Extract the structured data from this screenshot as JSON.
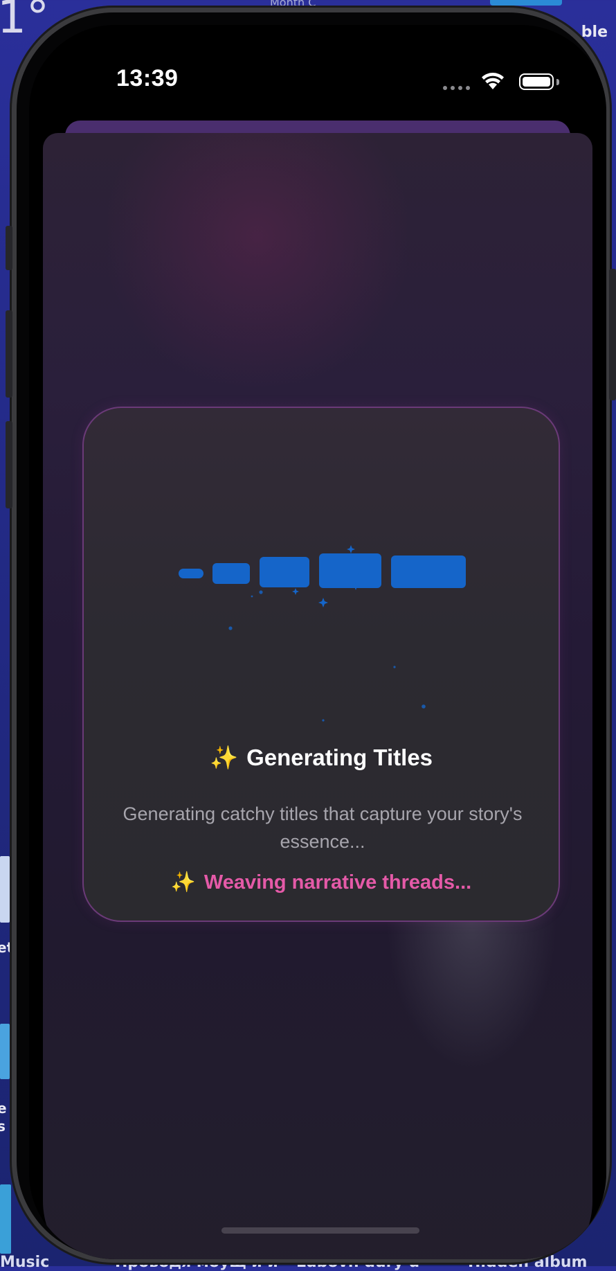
{
  "desktop": {
    "top_left_fragment": "1°",
    "top_fragment": "Month C",
    "top_right_fragment": "ble",
    "left_fragment_1": "et",
    "left_fragment_2": "e",
    "left_fragment_3": "s i",
    "bottom_labels": [
      "Music",
      "Проводя моущ и и",
      "Lubovn dury u",
      "Hidden album"
    ]
  },
  "status_bar": {
    "time": "13:39",
    "icons": [
      "signal-dots-icon",
      "wifi-icon",
      "battery-icon"
    ]
  },
  "loading_card": {
    "title_icon": "✨",
    "title": "Generating Titles",
    "subtitle": "Generating catchy titles that capture your story's essence...",
    "status_icon": "✨",
    "status": "Weaving narrative threads...",
    "accent_color": "#e55aa8",
    "bar_color": "#1565c9",
    "loading_bars": 5
  }
}
